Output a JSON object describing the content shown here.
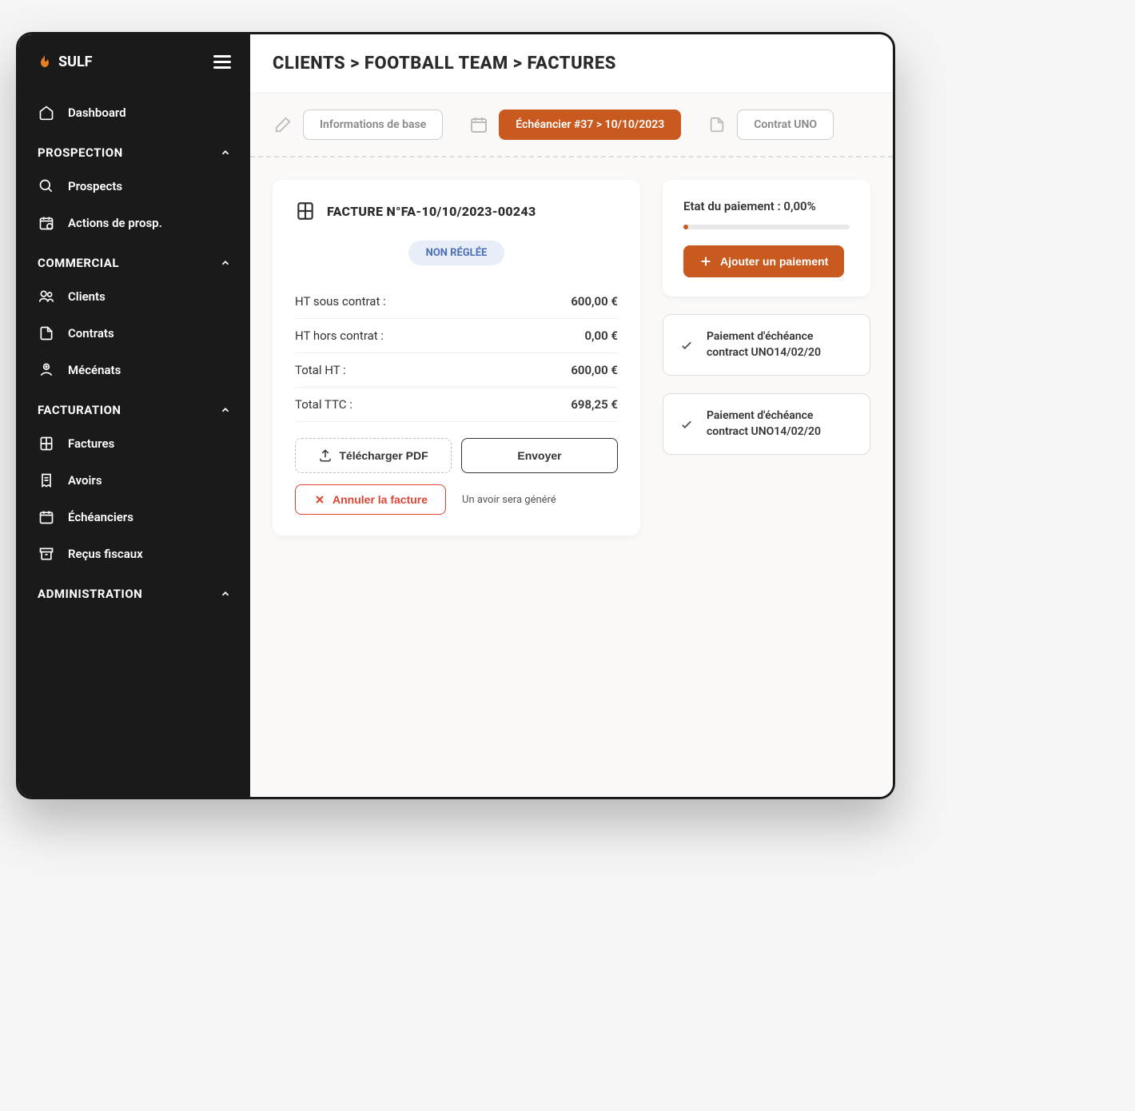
{
  "brand": "SULF",
  "breadcrumb": "CLIENTS > FOOTBALL TEAM > FACTURES",
  "sidebar": {
    "dashboard": "Dashboard",
    "sections": {
      "prospection": {
        "title": "PROSPECTION",
        "items": [
          "Prospects",
          "Actions de prosp."
        ]
      },
      "commercial": {
        "title": "COMMERCIAL",
        "items": [
          "Clients",
          "Contrats",
          "Mécénats"
        ]
      },
      "facturation": {
        "title": "FACTURATION",
        "items": [
          "Factures",
          "Avoirs",
          "Échéanciers",
          "Reçus fiscaux"
        ]
      },
      "administration": {
        "title": "ADMINISTRATION"
      }
    }
  },
  "tabs": {
    "info": "Informations de base",
    "schedule": "Échéancier #37 > 10/10/2023",
    "contract": "Contrat UNO"
  },
  "invoice": {
    "title": "FACTURE N°FA-10/10/2023-00243",
    "status": "NON RÉGLÉE",
    "rows": [
      {
        "label": "HT sous contrat :",
        "value": "600,00 €"
      },
      {
        "label": "HT hors contrat :",
        "value": "0,00 €"
      },
      {
        "label": "Total HT :",
        "value": "600,00 €"
      },
      {
        "label": "Total TTC :",
        "value": "698,25 €"
      }
    ],
    "download": "Télécharger PDF",
    "send": "Envoyer",
    "cancel": "Annuler la facture",
    "cancel_note": "Un avoir sera généré"
  },
  "payment": {
    "status_label": "Etat du paiement : 0,00%",
    "add_button": "Ajouter un paiement",
    "items": [
      "Paiement d'échéance contract UNO14/02/20",
      "Paiement d'échéance contract UNO14/02/20"
    ]
  }
}
